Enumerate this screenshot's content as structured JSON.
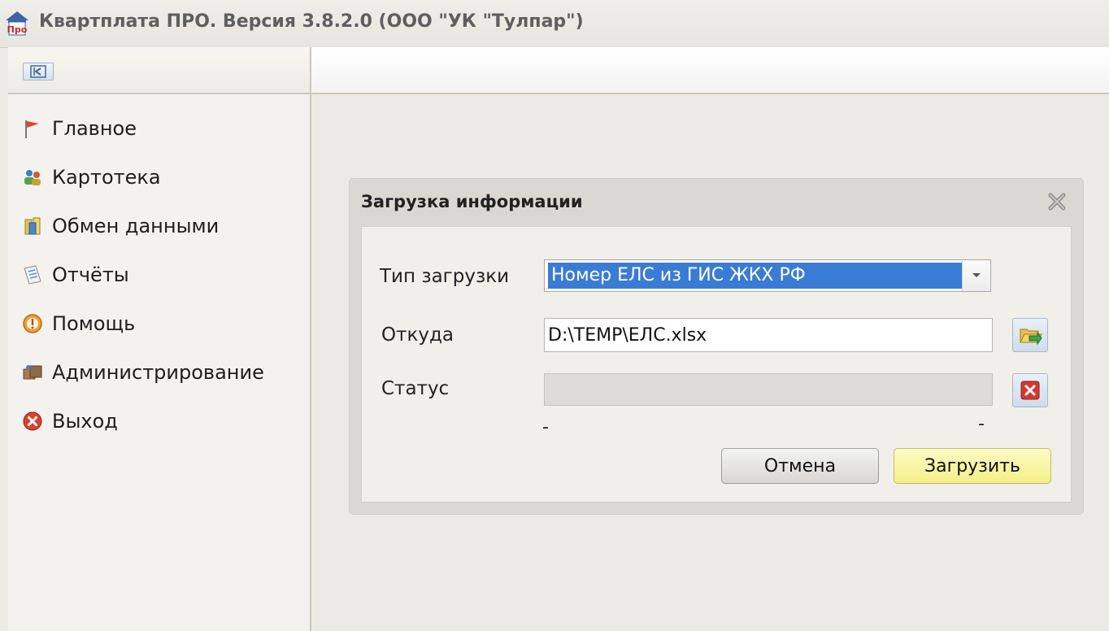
{
  "window": {
    "title": "Квартплата ПРО.  Версия 3.8.2.0 (ООО \"УК \"Тулпар\")",
    "logo_text": "Про"
  },
  "sidebar": {
    "items": [
      {
        "label": "Главное",
        "icon": "flag-icon"
      },
      {
        "label": "Картотека",
        "icon": "people-icon"
      },
      {
        "label": "Обмен данными",
        "icon": "data-exchange-icon"
      },
      {
        "label": "Отчёты",
        "icon": "reports-icon"
      },
      {
        "label": "Помощь",
        "icon": "help-icon"
      },
      {
        "label": "Администрирование",
        "icon": "admin-icon"
      },
      {
        "label": "Выход",
        "icon": "exit-icon"
      }
    ]
  },
  "dialog": {
    "title": "Загрузка информации",
    "type_label": "Тип загрузки",
    "type_value": "Номер ЕЛС  из ГИС ЖКХ РФ",
    "from_label": "Откуда",
    "from_value": "D:\\TEMP\\ЕЛС.xlsx",
    "status_label": "Статус",
    "progress_left": "-",
    "progress_right": "-",
    "cancel_label": "Отмена",
    "load_label": "Загрузить"
  },
  "colors": {
    "selection": "#3a7cd4",
    "load_button": "#f4ef86",
    "panel_bg": "#f3f2ee"
  }
}
